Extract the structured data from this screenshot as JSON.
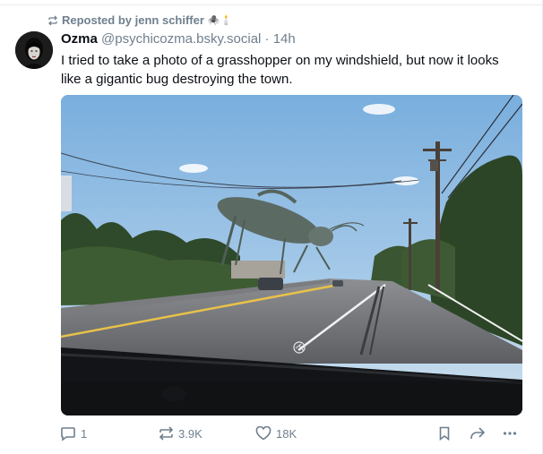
{
  "repost": {
    "text": "Reposted by jenn schiffer",
    "emoji": "🕷️🕯️"
  },
  "post": {
    "author_name": "Ozma",
    "author_handle": "@psychicozma.bsky.social",
    "separator": "·",
    "timestamp": "14h",
    "text": "I tried to take a photo of a grasshopper on my windshield, but now it looks like a gigantic bug destroying the town."
  },
  "actions": {
    "reply_count": "1",
    "repost_count": "3.9K",
    "like_count": "18K"
  },
  "colors": {
    "muted": "#6f7f8e",
    "text": "#0b0f14",
    "sky": "#8ab6e0"
  },
  "icons": [
    "repost-icon",
    "reply-icon",
    "like-icon",
    "bookmark-icon",
    "share-icon",
    "more-icon"
  ]
}
